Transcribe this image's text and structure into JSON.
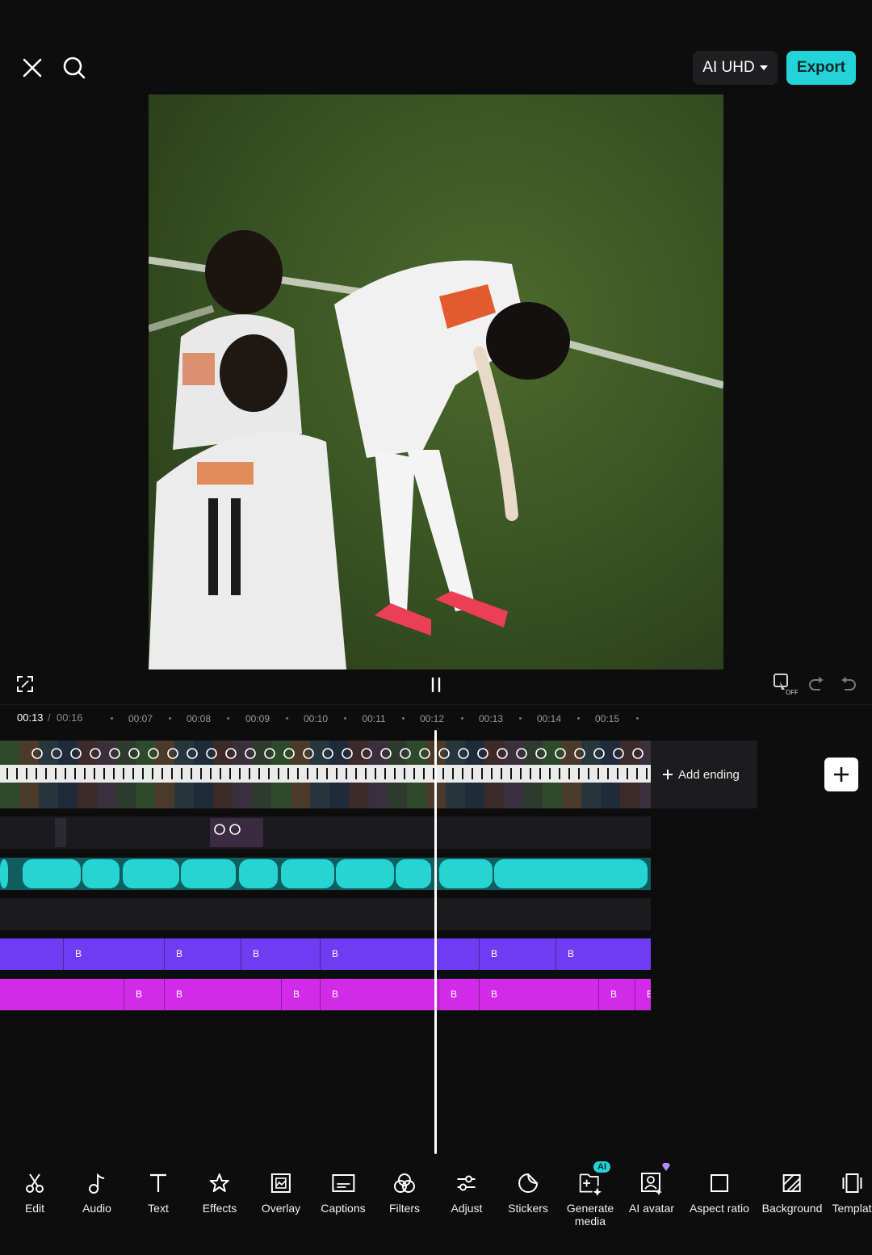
{
  "header": {
    "quality_label": "AI UHD",
    "export_label": "Export"
  },
  "timeline": {
    "current_time": "00:13",
    "separator": "/",
    "total_time": "00:16",
    "ticks": [
      "00:07",
      "00:08",
      "00:09",
      "00:10",
      "00:11",
      "00:12",
      "00:13",
      "00:14",
      "00:15"
    ],
    "add_ending_label": "Add ending",
    "effect_track_a_labels": [
      "B",
      "B",
      "B",
      "B",
      "B",
      "B"
    ],
    "effect_track_b_labels": [
      "B",
      "B",
      "B",
      "B",
      "B",
      "B",
      "B",
      "B"
    ]
  },
  "toolbar": {
    "items": [
      {
        "label": "Edit",
        "icon": "scissors-icon"
      },
      {
        "label": "Audio",
        "icon": "music-note-icon"
      },
      {
        "label": "Text",
        "icon": "text-icon"
      },
      {
        "label": "Effects",
        "icon": "sparkle-star-icon"
      },
      {
        "label": "Overlay",
        "icon": "overlay-image-icon"
      },
      {
        "label": "Captions",
        "icon": "captions-icon"
      },
      {
        "label": "Filters",
        "icon": "filters-icon"
      },
      {
        "label": "Adjust",
        "icon": "sliders-icon"
      },
      {
        "label": "Stickers",
        "icon": "sticker-icon"
      },
      {
        "label": "Generate media",
        "icon": "generate-media-icon",
        "badge": "AI"
      },
      {
        "label": "AI avatar",
        "icon": "avatar-icon"
      },
      {
        "label": "Aspect ratio",
        "icon": "aspect-ratio-icon"
      },
      {
        "label": "Background",
        "icon": "background-icon"
      },
      {
        "label": "Templat",
        "icon": "template-icon"
      }
    ]
  },
  "colors": {
    "accent": "#22d3d8",
    "effect_track_a": "#6f3cf2",
    "effect_track_b": "#d22be8",
    "audio_wave": "#27d4d4"
  }
}
